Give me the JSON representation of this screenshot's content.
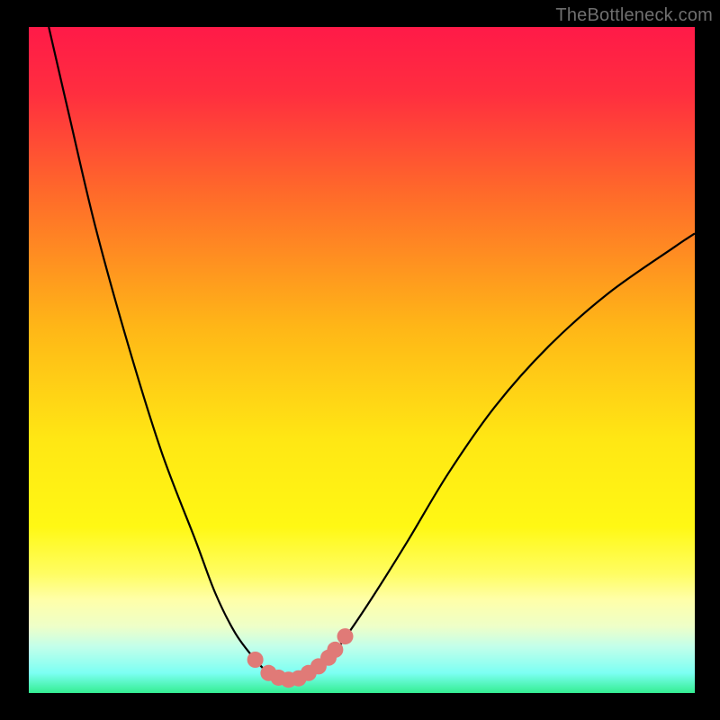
{
  "watermark": "TheBottleneck.com",
  "colors": {
    "gradient_stops": [
      {
        "offset": 0.0,
        "color": "#ff1a48"
      },
      {
        "offset": 0.1,
        "color": "#ff2e3f"
      },
      {
        "offset": 0.25,
        "color": "#ff6a2a"
      },
      {
        "offset": 0.45,
        "color": "#ffb617"
      },
      {
        "offset": 0.62,
        "color": "#ffe714"
      },
      {
        "offset": 0.75,
        "color": "#fff814"
      },
      {
        "offset": 0.82,
        "color": "#fffd61"
      },
      {
        "offset": 0.86,
        "color": "#ffffa9"
      },
      {
        "offset": 0.9,
        "color": "#eeffc8"
      },
      {
        "offset": 0.93,
        "color": "#c3ffea"
      },
      {
        "offset": 0.97,
        "color": "#7cfff3"
      },
      {
        "offset": 1.0,
        "color": "#34ee92"
      }
    ],
    "curve_stroke": "#000000",
    "marker_fill": "#e07a77",
    "marker_stroke": "#e07a77",
    "background": "#000000"
  },
  "chart_data": {
    "type": "line",
    "title": "",
    "xlabel": "",
    "ylabel": "",
    "xlim": [
      0,
      100
    ],
    "ylim": [
      0,
      100
    ],
    "grid": false,
    "legend": false,
    "series": [
      {
        "name": "bottleneck-curve",
        "x": [
          3,
          6,
          10,
          15,
          20,
          25,
          28,
          31,
          34,
          36,
          38,
          40,
          42,
          45,
          48,
          52,
          57,
          63,
          70,
          78,
          87,
          97,
          100
        ],
        "y": [
          100,
          87,
          70,
          52,
          36,
          23,
          15,
          9,
          5,
          3,
          2,
          2,
          3,
          5,
          9,
          15,
          23,
          33,
          43,
          52,
          60,
          67,
          69
        ]
      }
    ],
    "markers": {
      "name": "highlight-points",
      "x": [
        34.0,
        36.0,
        37.5,
        39.0,
        40.5,
        42.0,
        43.5,
        45.0,
        46.0,
        47.5
      ],
      "y": [
        5.0,
        3.0,
        2.3,
        2.0,
        2.2,
        3.0,
        4.0,
        5.3,
        6.5,
        8.5
      ]
    }
  }
}
